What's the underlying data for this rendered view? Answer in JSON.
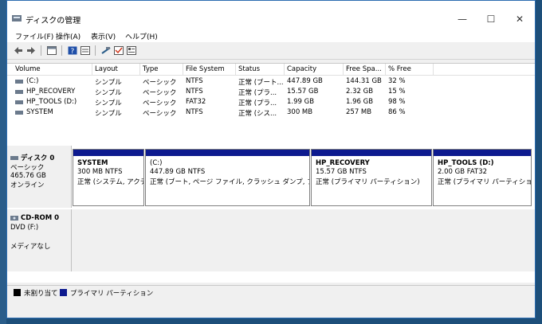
{
  "window": {
    "title": "ディスクの管理"
  },
  "menu": [
    "ファイル(F)",
    "操作(A)",
    "表示(V)",
    "ヘルプ(H)"
  ],
  "columns": [
    "Volume",
    "Layout",
    "Type",
    "File System",
    "Status",
    "Capacity",
    "Free Spa...",
    "% Free"
  ],
  "volumes": [
    {
      "volume": "(C:)",
      "layout": "シンプル",
      "type": "ベーシック",
      "fs": "NTFS",
      "status": "正常 (ブート...",
      "capacity": "447.89 GB",
      "free": "144.31 GB",
      "pct": "32 %"
    },
    {
      "volume": "HP_RECOVERY",
      "layout": "シンプル",
      "type": "ベーシック",
      "fs": "NTFS",
      "status": "正常 (プラ...",
      "capacity": "15.57 GB",
      "free": "2.32 GB",
      "pct": "15 %"
    },
    {
      "volume": "HP_TOOLS (D:)",
      "layout": "シンプル",
      "type": "ベーシック",
      "fs": "FAT32",
      "status": "正常 (プラ...",
      "capacity": "1.99 GB",
      "free": "1.96 GB",
      "pct": "98 %"
    },
    {
      "volume": "SYSTEM",
      "layout": "シンプル",
      "type": "ベーシック",
      "fs": "NTFS",
      "status": "正常 (シス...",
      "capacity": "300 MB",
      "free": "257 MB",
      "pct": "86 %"
    }
  ],
  "disk0": {
    "name": "ディスク 0",
    "type": "ベーシック",
    "size": "465.76 GB",
    "state": "オンライン",
    "partitions": [
      {
        "name": "SYSTEM",
        "size": "300 MB NTFS",
        "status": "正常 (システム, アクティ"
      },
      {
        "name": "(C:)",
        "size": "447.89 GB NTFS",
        "status": "正常 (ブート, ページ ファイル, クラッシュ ダンプ, プライマリ"
      },
      {
        "name": "HP_RECOVERY",
        "size": "15.57 GB NTFS",
        "status": "正常 (プライマリ パーティション)"
      },
      {
        "name": "HP_TOOLS  (D:)",
        "size": "2.00 GB FAT32",
        "status": "正常 (プライマリ パーティション)"
      }
    ]
  },
  "cdrom0": {
    "name": "CD-ROM 0",
    "drive": "DVD (F:)",
    "media": "メディアなし"
  },
  "legend": [
    {
      "label": "未割り当て",
      "color": "#000000"
    },
    {
      "label": "プライマリ パーティション",
      "color": "#0d1a8f"
    }
  ],
  "icons": {
    "back": "back-arrow-icon",
    "forward": "forward-arrow-icon",
    "properties": "properties-icon",
    "help": "help-icon",
    "view": "view-icon",
    "connect": "connect-icon",
    "check": "check-icon",
    "settings": "settings-icon"
  }
}
